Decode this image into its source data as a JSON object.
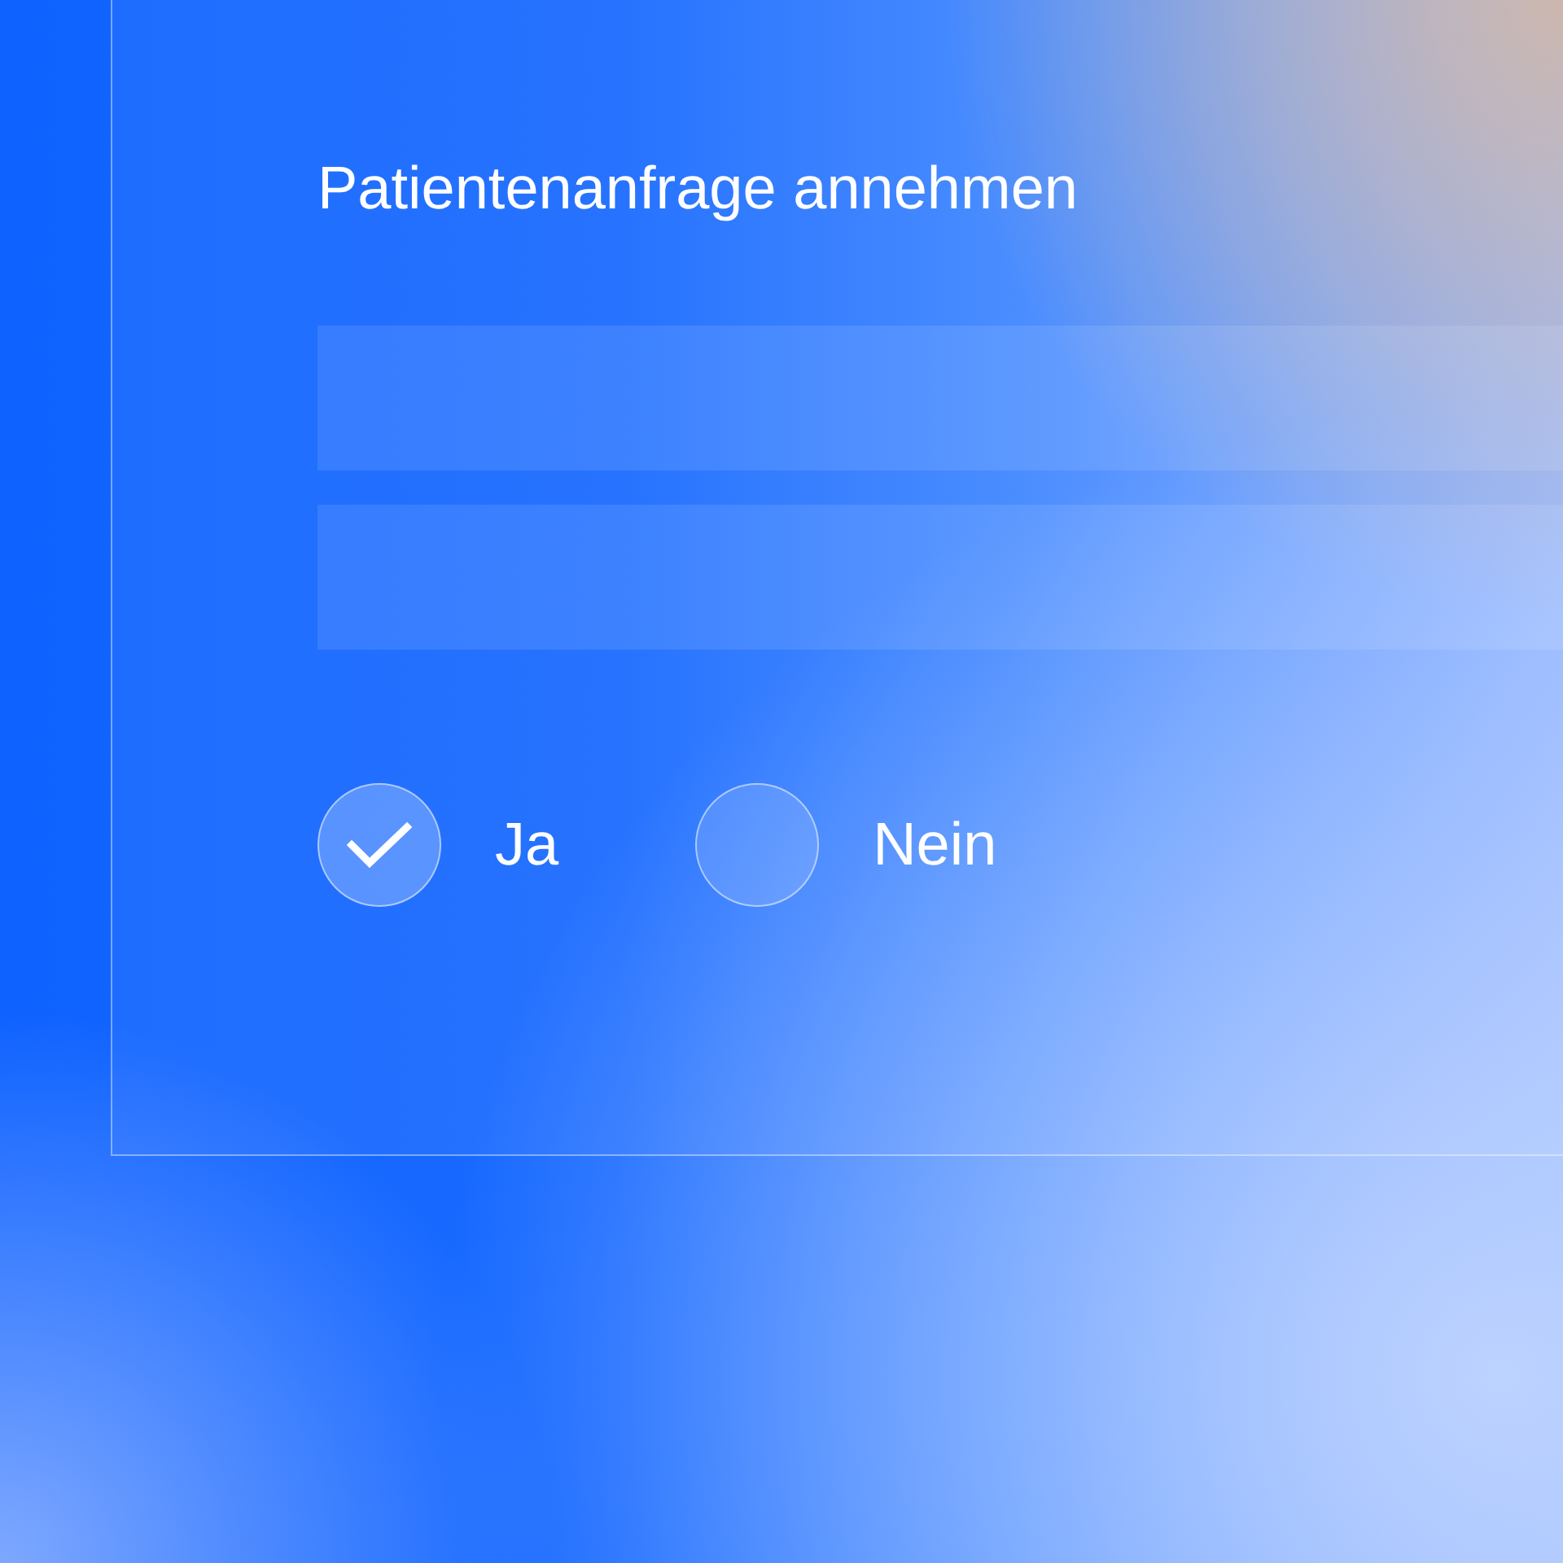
{
  "form": {
    "title": "Patientenanfrage annehmen",
    "input_fields": [
      {
        "kind": "text"
      },
      {
        "kind": "text"
      }
    ],
    "options": [
      {
        "label": "Ja",
        "selected": true
      },
      {
        "label": "Nein",
        "selected": false
      }
    ]
  }
}
